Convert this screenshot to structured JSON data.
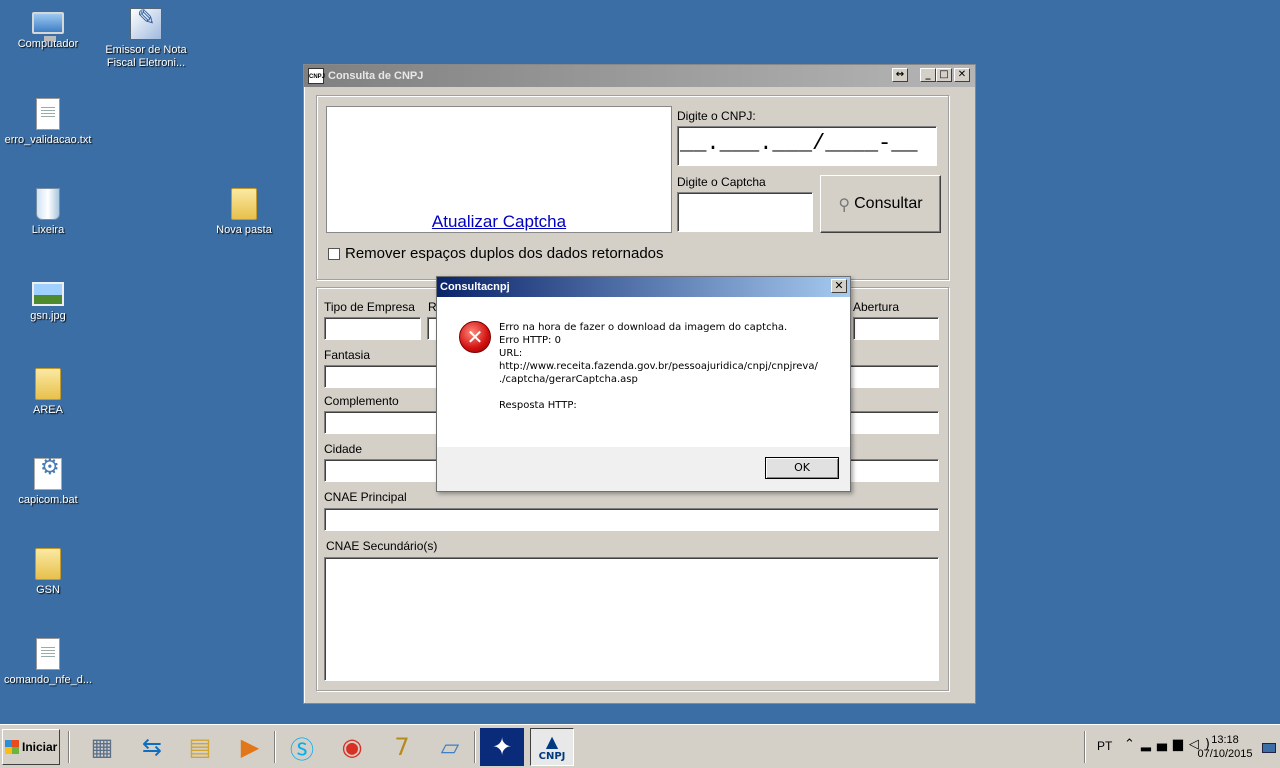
{
  "desktop": {
    "icons": [
      {
        "label": "Computador"
      },
      {
        "label": "Emissor de Nota\nFiscal Eletroni..."
      },
      {
        "label": "erro_validacao.txt"
      },
      {
        "label": "Lixeira"
      },
      {
        "label": "Nova pasta"
      },
      {
        "label": "gsn.jpg"
      },
      {
        "label": "AREA"
      },
      {
        "label": "capicom.bat"
      },
      {
        "label": "GSN"
      },
      {
        "label": "comando_nfe_d..."
      }
    ]
  },
  "window": {
    "title": "Consulta de CNPJ",
    "app_icon_text": "CNPJ",
    "buttons": {
      "resize": "↔",
      "minimize": "_",
      "maximize": "□",
      "close": "✕"
    },
    "captcha_link": "Atualizar Captcha",
    "cnpj_label": "Digite o CNPJ:",
    "cnpj_mask": "__.___.___/____-__",
    "captcha_label": "Digite o Captcha",
    "consult_button": "Consultar",
    "remove_spaces_label": "Remover espaços duplos dos dados retornados",
    "fields": {
      "tipo_empresa": "Tipo de Empresa",
      "r_partial": "R",
      "abertura": "Abertura",
      "fantasia": "Fantasia",
      "complemento": "Complemento",
      "cidade": "Cidade",
      "cnae_principal": "CNAE Principal",
      "cnae_secundario": "CNAE Secundário(s)"
    }
  },
  "dialog": {
    "title": "Consultacnpj",
    "close": "✕",
    "lines": [
      "Erro na hora de fazer o download da imagem do captcha.",
      "Erro HTTP: 0",
      "URL:",
      "http://www.receita.fazenda.gov.br/pessoajuridica/cnpj/cnpjreva/",
      "./captcha/gerarCaptcha.asp",
      "",
      "Resposta HTTP:"
    ],
    "ok": "OK"
  },
  "taskbar": {
    "start": "Iniciar",
    "language": "PT",
    "time": "13:18",
    "date": "07/10/2015",
    "active_app_label": "CNPJ"
  }
}
